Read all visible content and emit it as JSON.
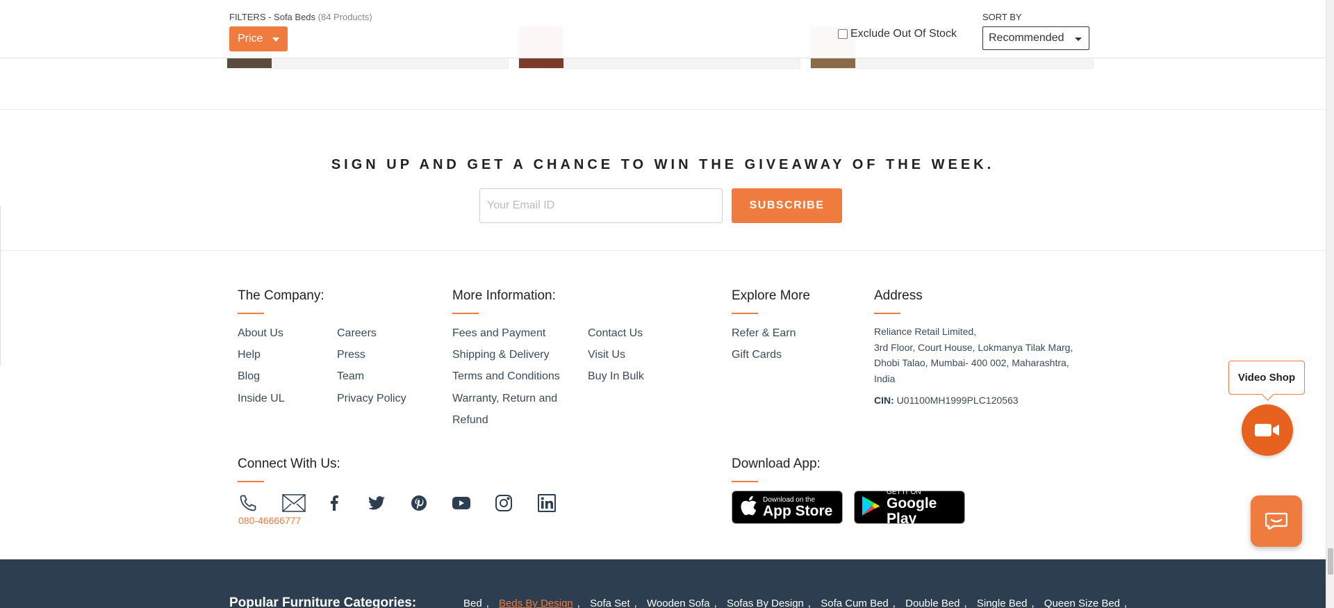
{
  "filter_bar": {
    "title": "FILTERS - Sofa Beds",
    "count": "(84 Products)",
    "price_label": "Price",
    "exclude_label": "Exclude Out Of Stock",
    "sort_label": "SORT BY",
    "sort_value": "Recommended"
  },
  "newsletter": {
    "heading": "SIGN UP AND GET A CHANCE TO WIN THE GIVEAWAY OF THE WEEK.",
    "email_placeholder": "Your Email ID",
    "subscribe_label": "SUBSCRIBE"
  },
  "company": {
    "heading": "The Company:",
    "col1": [
      "About Us",
      "Help",
      "Blog",
      "Inside UL"
    ],
    "col2": [
      "Careers",
      "Press",
      "Team",
      "Privacy Policy"
    ]
  },
  "more_info": {
    "heading": "More Information:",
    "col1": [
      "Fees and Payment",
      "Shipping & Delivery",
      "Terms and Conditions",
      "Warranty, Return and",
      "Refund"
    ],
    "col2": [
      "Contact Us",
      "Visit Us",
      "Buy In Bulk"
    ]
  },
  "explore": {
    "heading": "Explore More",
    "items": [
      "Refer & Earn",
      "Gift Cards"
    ]
  },
  "address": {
    "heading": "Address",
    "lines": [
      "Reliance Retail Limited,",
      "3rd Floor, Court House, Lokmanya Tilak Marg,",
      "Dhobi Talao, Mumbai- 400 002, Maharashtra,",
      "India"
    ],
    "cin_label": "CIN:",
    "cin_value": "U01100MH1999PLC120563"
  },
  "connect": {
    "heading": "Connect With Us:",
    "phone": "080-46666777",
    "icons": [
      "phone-icon",
      "mail-icon",
      "facebook-icon",
      "twitter-icon",
      "pinterest-icon",
      "youtube-icon",
      "instagram-icon",
      "linkedin-icon"
    ]
  },
  "download": {
    "heading": "Download App:",
    "appstore_small": "Download on the",
    "appstore_big": "App Store",
    "play_small": "GET IT ON",
    "play_big": "Google Play"
  },
  "widgets": {
    "video_shop_label": "Video Shop"
  },
  "popular": {
    "heading": "Popular Furniture Categories:",
    "items": [
      "Bed",
      "Beds By Design",
      "Sofa Set",
      "Wooden Sofa",
      "Sofas By Design",
      "Sofa Cum Bed",
      "Double Bed",
      "Single Bed",
      "Queen Size Bed"
    ],
    "active_index": 1
  },
  "colors": {
    "accent": "#f07b3f",
    "dark_band": "#2c3e50",
    "text": "#2c3e50"
  }
}
